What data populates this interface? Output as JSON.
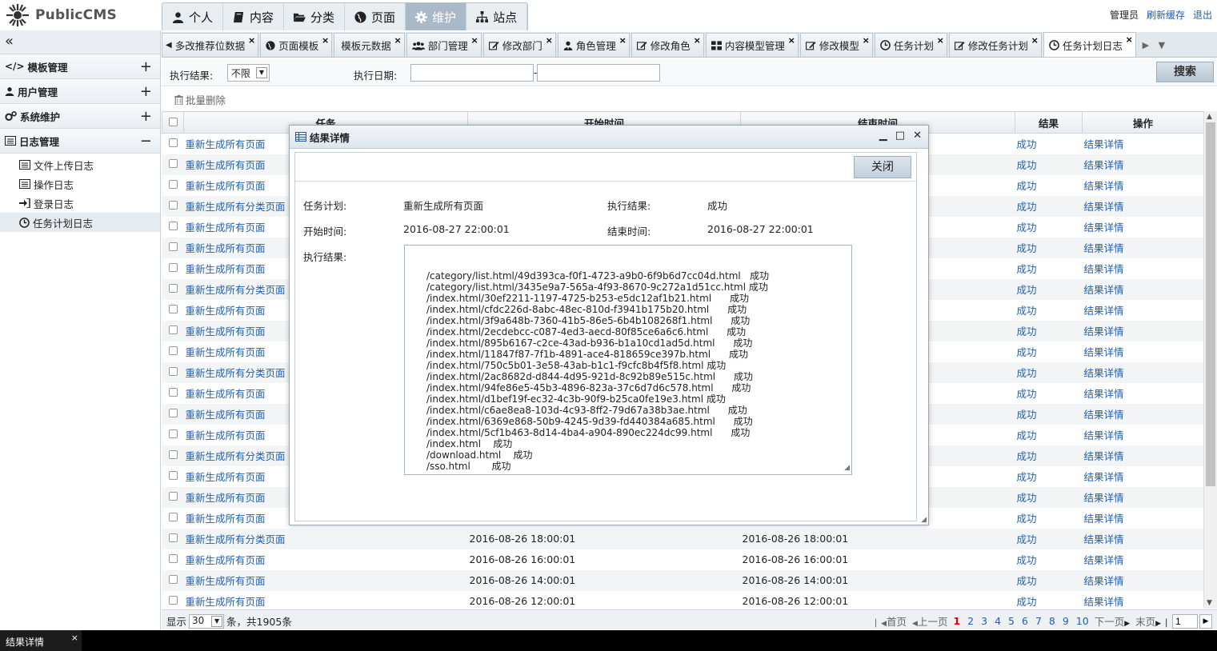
{
  "header": {
    "logo_text": "PublicCMS",
    "nav": [
      {
        "label": "个人",
        "icon": "user-icon"
      },
      {
        "label": "内容",
        "icon": "book-icon"
      },
      {
        "label": "分类",
        "icon": "folder-open-icon"
      },
      {
        "label": "页面",
        "icon": "globe-icon"
      },
      {
        "label": "维护",
        "icon": "gear-icon",
        "active": true
      },
      {
        "label": "站点",
        "icon": "sitemap-icon"
      }
    ],
    "user": "管理员",
    "refresh_cache": "刷新缓存",
    "logout": "退出"
  },
  "sidebar": {
    "collapse": "«",
    "groups": [
      {
        "label": "模板管理",
        "icon": "code-icon",
        "toggle": "+"
      },
      {
        "label": "用户管理",
        "icon": "user-icon",
        "toggle": "+"
      },
      {
        "label": "系统维护",
        "icon": "gears-icon",
        "toggle": "+"
      },
      {
        "label": "日志管理",
        "icon": "list-icon",
        "toggle": "−"
      }
    ],
    "subitems": [
      {
        "label": "文件上传日志",
        "icon": "list-icon"
      },
      {
        "label": "操作日志",
        "icon": "list-icon"
      },
      {
        "label": "登录日志",
        "icon": "sign-in-icon"
      },
      {
        "label": "任务计划日志",
        "icon": "clock-icon",
        "active": true
      }
    ]
  },
  "tabs": [
    {
      "label": "多改推荐位数据",
      "icon": "arrow-left-icon"
    },
    {
      "label": "页面模板",
      "icon": "globe-icon"
    },
    {
      "label": "模板元数据",
      "icon": ""
    },
    {
      "label": "部门管理",
      "icon": "users-icon"
    },
    {
      "label": "修改部门",
      "icon": "edit-icon"
    },
    {
      "label": "角色管理",
      "icon": "user-tie-icon"
    },
    {
      "label": "修改角色",
      "icon": "edit-icon"
    },
    {
      "label": "内容模型管理",
      "icon": "grid-icon"
    },
    {
      "label": "修改模型",
      "icon": "edit-icon"
    },
    {
      "label": "任务计划",
      "icon": "clock-icon"
    },
    {
      "label": "修改任务计划",
      "icon": "edit-icon"
    },
    {
      "label": "任务计划日志",
      "icon": "clock-icon",
      "active": true
    }
  ],
  "tab_close": "×",
  "filter": {
    "result_label": "执行结果:",
    "result_value": "不限",
    "date_label": "执行日期:",
    "date_sep": "-",
    "search": "搜索"
  },
  "toolbar": {
    "batch_delete": "批量删除"
  },
  "grid": {
    "headers": [
      "任务",
      "开始时间",
      "结束时间",
      "结果",
      "操作"
    ],
    "rows": [
      {
        "task": "重新生成所有页面",
        "start": "",
        "end": "",
        "result": "成功",
        "op": "结果详情"
      },
      {
        "task": "重新生成所有页面",
        "start": "",
        "end": "",
        "result": "成功",
        "op": "结果详情"
      },
      {
        "task": "重新生成所有页面",
        "start": "",
        "end": "",
        "result": "成功",
        "op": "结果详情"
      },
      {
        "task": "重新生成所有分类页面",
        "start": "",
        "end": "",
        "result": "成功",
        "op": "结果详情"
      },
      {
        "task": "重新生成所有页面",
        "start": "",
        "end": "",
        "result": "成功",
        "op": "结果详情"
      },
      {
        "task": "重新生成所有页面",
        "start": "",
        "end": "",
        "result": "成功",
        "op": "结果详情"
      },
      {
        "task": "重新生成所有页面",
        "start": "",
        "end": "",
        "result": "成功",
        "op": "结果详情"
      },
      {
        "task": "重新生成所有分类页面",
        "start": "",
        "end": "",
        "result": "成功",
        "op": "结果详情"
      },
      {
        "task": "重新生成所有页面",
        "start": "",
        "end": "",
        "result": "成功",
        "op": "结果详情"
      },
      {
        "task": "重新生成所有页面",
        "start": "",
        "end": "",
        "result": "成功",
        "op": "结果详情"
      },
      {
        "task": "重新生成所有页面",
        "start": "",
        "end": "",
        "result": "成功",
        "op": "结果详情"
      },
      {
        "task": "重新生成所有分类页面",
        "start": "",
        "end": "",
        "result": "成功",
        "op": "结果详情"
      },
      {
        "task": "重新生成所有页面",
        "start": "",
        "end": "",
        "result": "成功",
        "op": "结果详情"
      },
      {
        "task": "重新生成所有页面",
        "start": "",
        "end": "",
        "result": "成功",
        "op": "结果详情"
      },
      {
        "task": "重新生成所有页面",
        "start": "",
        "end": "",
        "result": "成功",
        "op": "结果详情"
      },
      {
        "task": "重新生成所有分类页面",
        "start": "",
        "end": "",
        "result": "成功",
        "op": "结果详情"
      },
      {
        "task": "重新生成所有页面",
        "start": "",
        "end": "",
        "result": "成功",
        "op": "结果详情"
      },
      {
        "task": "重新生成所有页面",
        "start": "",
        "end": "",
        "result": "成功",
        "op": "结果详情"
      },
      {
        "task": "重新生成所有页面",
        "start": "",
        "end": "",
        "result": "成功",
        "op": "结果详情"
      },
      {
        "task": "重新生成所有分类页面",
        "start": "2016-08-26 18:00:01",
        "end": "2016-08-26 18:00:01",
        "result": "成功",
        "op": "结果详情"
      },
      {
        "task": "重新生成所有页面",
        "start": "2016-08-26 16:00:01",
        "end": "2016-08-26 16:00:01",
        "result": "成功",
        "op": "结果详情"
      },
      {
        "task": "重新生成所有页面",
        "start": "2016-08-26 14:00:01",
        "end": "2016-08-26 14:00:01",
        "result": "成功",
        "op": "结果详情"
      },
      {
        "task": "重新生成所有页面",
        "start": "2016-08-26 12:00:01",
        "end": "2016-08-26 12:00:01",
        "result": "成功",
        "op": "结果详情"
      }
    ]
  },
  "pager": {
    "show": "显示",
    "page_size": "30",
    "summary": "条，共1905条",
    "first": "首页",
    "prev": "上一页",
    "pages": [
      "1",
      "2",
      "3",
      "4",
      "5",
      "6",
      "7",
      "8",
      "9",
      "10"
    ],
    "current": "1",
    "next": "下一页",
    "last": "末页",
    "goto_value": "1"
  },
  "taskbar": {
    "item": "结果详情",
    "close": "×"
  },
  "modal": {
    "title": "结果详情",
    "close": "关闭",
    "task_label": "任务计划:",
    "task_value": "重新生成所有页面",
    "exec_result_label": "执行结果:",
    "exec_result_value": "成功",
    "start_label": "开始时间:",
    "start_value": "2016-08-27 22:00:01",
    "end_label": "结束时间:",
    "end_value": "2016-08-27 22:00:01",
    "result_label": "执行结果:",
    "result_lines": [
      "/category/list.html/49d393ca-f0f1-4723-a9b0-6f9b6d7cc04d.html   成功",
      "/category/list.html/3435e9a7-565a-4f93-8670-9c272a1d51cc.html 成功",
      "/index.html/30ef2211-1197-4725-b253-e5dc12af1b21.html      成功",
      "/index.html/cfdc226d-8abc-48ec-810d-f3941b175b20.html      成功",
      "/index.html/3f9a648b-7360-41b5-86e5-6b4b108268f1.html      成功",
      "/index.html/2ecdebcc-c087-4ed3-aecd-80f85ce6a6c6.html      成功",
      "/index.html/895b6167-c2ce-43ad-b936-b1a10cd1ad5d.html      成功",
      "/index.html/11847f87-7f1b-4891-ace4-818659ce397b.html      成功",
      "/index.html/750c5b01-3e58-43ab-b1c1-f9cfc8b4f5f8.html 成功",
      "/index.html/2ac8682d-d844-4d95-921d-8c92b89e515c.html      成功",
      "/index.html/94fe86e5-45b3-4896-823a-37c6d7d6c578.html      成功",
      "/index.html/d1bef19f-ec32-4c3b-90f9-b25ca0fe19e3.html 成功",
      "/index.html/c6ae8ea8-103d-4c93-8ff2-79d67a38b3ae.html      成功",
      "/index.html/6369e868-50b9-4245-9d39-fd440384a685.html      成功",
      "/index.html/5cf1b463-8d14-4ba4-a904-890ec224dc99.html      成功",
      "/index.html    成功",
      "/download.html    成功",
      "/sso.html       成功"
    ]
  }
}
